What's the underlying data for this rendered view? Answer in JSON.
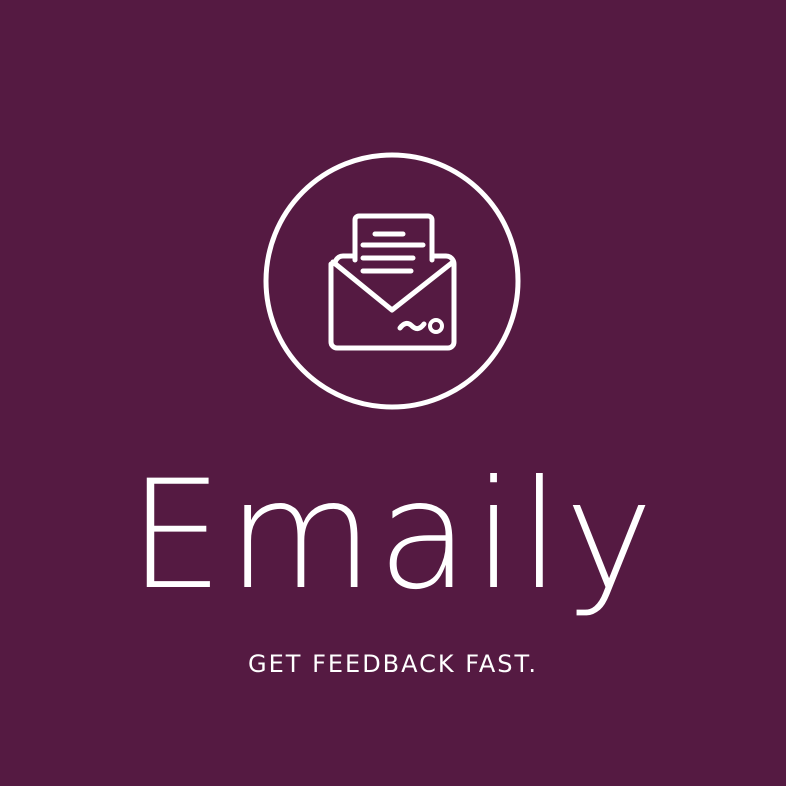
{
  "brand": {
    "name": "Emaily",
    "tagline": "GET FEEDBACK FAST."
  },
  "logo": {
    "icon": "open-envelope-with-letter-icon",
    "stroke_color": "#ffffff",
    "background_color": "#551a42"
  }
}
